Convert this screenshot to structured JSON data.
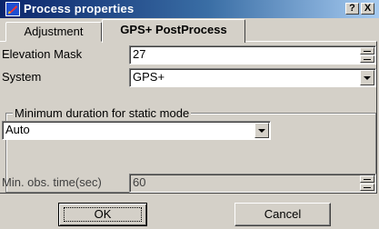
{
  "window": {
    "title": "Process properties",
    "help_label": "?",
    "close_label": "X",
    "title_bar_color": "#0a246a"
  },
  "tabs": [
    {
      "label": "Adjustment",
      "active": false
    },
    {
      "label": "GPS+ PostProcess",
      "active": true
    }
  ],
  "form": {
    "elevation_mask": {
      "label": "Elevation Mask",
      "value": "27"
    },
    "system": {
      "label": "System",
      "value": "GPS+"
    },
    "min_duration_group": {
      "title": "Minimum duration for static mode",
      "mode": {
        "value": "Auto"
      },
      "min_obs_time": {
        "label": "Min. obs. time(sec)",
        "value": "60"
      }
    }
  },
  "buttons": {
    "ok": "OK",
    "cancel": "Cancel"
  },
  "icons": {
    "title_icon": "app-icon",
    "spin": "spin-buttons",
    "dropdown": "dropdown-arrow-icon"
  }
}
